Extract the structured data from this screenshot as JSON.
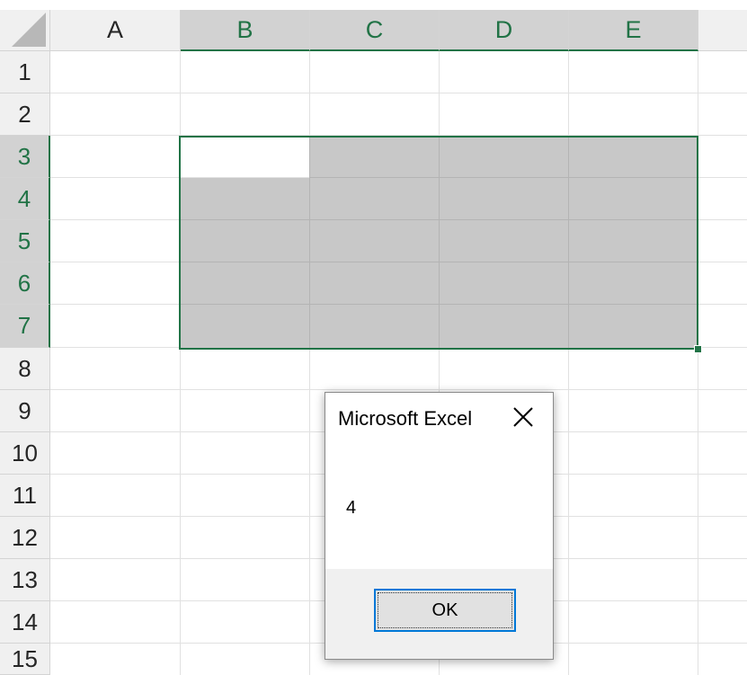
{
  "columns": [
    "A",
    "B",
    "C",
    "D",
    "E"
  ],
  "rows": [
    "1",
    "2",
    "3",
    "4",
    "5",
    "6",
    "7",
    "8",
    "9",
    "10",
    "11",
    "12",
    "13",
    "14",
    "15"
  ],
  "selection": {
    "range": "B3:E7",
    "active_cell": "B3"
  },
  "colors": {
    "selection_accent": "#217346",
    "selection_fill": "#c8c8c8",
    "dialog_button_border": "#0078d7"
  },
  "dialog": {
    "title": "Microsoft Excel",
    "message": "4",
    "ok_label": "OK",
    "close_icon": "close-icon"
  }
}
